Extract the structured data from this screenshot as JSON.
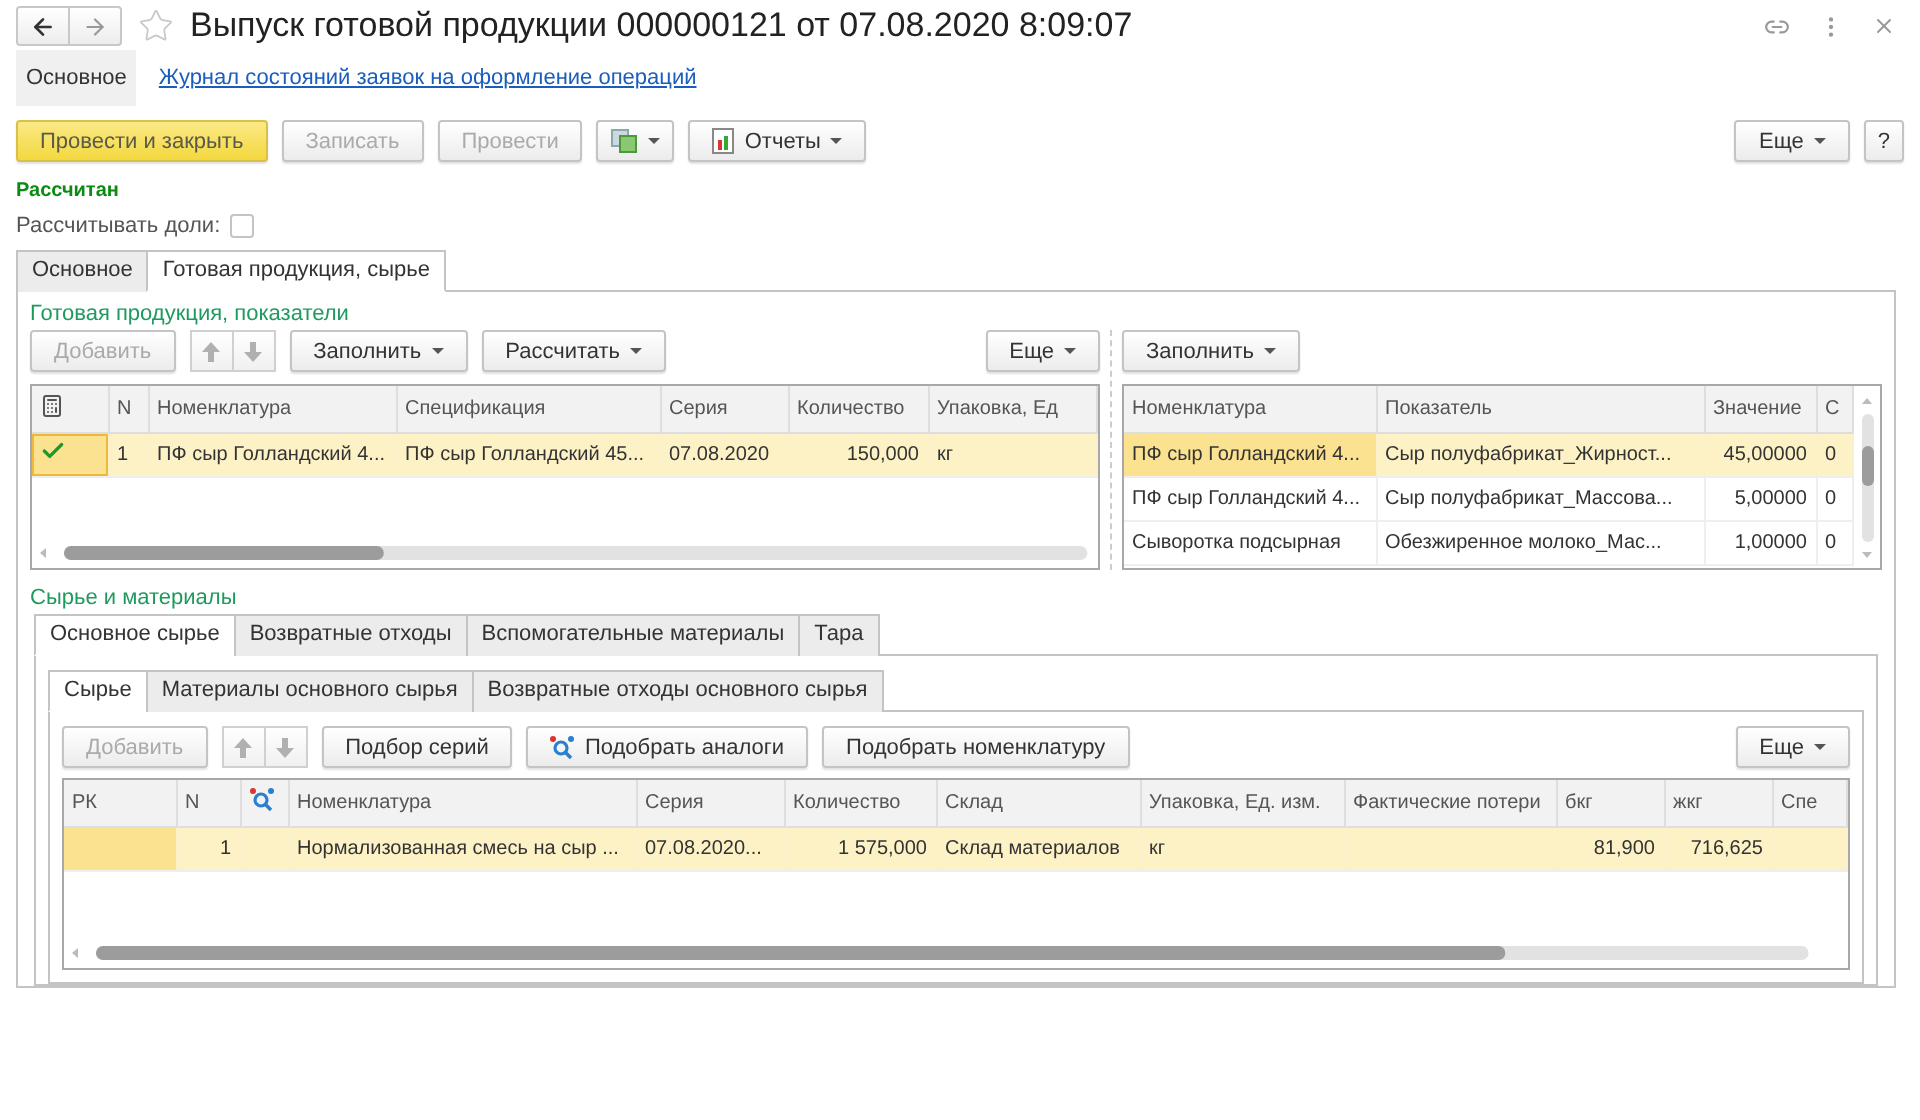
{
  "window": {
    "title": "Выпуск готовой продукции 000000121 от 07.08.2020 8:09:07"
  },
  "form_nav": [
    {
      "label": "Основное",
      "selected": true
    },
    {
      "label": "Журнал состояний заявок на оформление операций",
      "selected": false
    }
  ],
  "toolbar": {
    "buttons": [
      {
        "label": "Провести и закрыть",
        "kind": "primary",
        "disabled": false
      },
      {
        "label": "Записать",
        "kind": "plain",
        "disabled": true
      },
      {
        "label": "Провести",
        "kind": "plain",
        "disabled": true
      },
      {
        "kind": "related",
        "disabled": false
      },
      {
        "label": "Отчеты",
        "kind": "reports",
        "disabled": false
      }
    ],
    "right": [
      {
        "label": "Еще",
        "kind": "menu",
        "disabled": false
      },
      {
        "label": "?",
        "kind": "plain",
        "disabled": false
      }
    ]
  },
  "status": "Рассчитан",
  "calc_shares": {
    "label": "Рассчитывать доли:",
    "checked": false
  },
  "tabs": [
    {
      "label": "Основное",
      "selected": false
    },
    {
      "label": "Готовая продукция, сырье",
      "selected": true
    }
  ],
  "products": {
    "title": "Готовая продукция, показатели",
    "left": {
      "toolbar": [
        {
          "label": "Добавить",
          "kind": "plain",
          "disabled": true
        },
        {
          "kind": "up",
          "disabled": true
        },
        {
          "kind": "down",
          "disabled": true
        },
        {
          "label": "Заполнить",
          "kind": "menu",
          "disabled": false
        },
        {
          "label": "Рассчитать",
          "kind": "menu",
          "disabled": false
        }
      ],
      "toolbar_right": [
        {
          "label": "Еще",
          "kind": "menu",
          "disabled": false
        }
      ],
      "columns": [
        {
          "kind": "check"
        },
        {
          "label": "N",
          "kind": "text"
        },
        {
          "label": "Номенклатура",
          "kind": "text"
        },
        {
          "label": "Спецификация",
          "kind": "text"
        },
        {
          "label": "Серия",
          "kind": "text"
        },
        {
          "label": "Количество",
          "kind": "number"
        },
        {
          "label": "Упаковка, Ед",
          "kind": "text"
        }
      ],
      "rows": [
        {
          "selected": true,
          "calculated": true,
          "cells": [
            null,
            "1",
            "ПФ сыр Голландский 4...",
            "ПФ сыр Голландский 45...",
            "07.08.2020",
            "150,000",
            "кг"
          ]
        }
      ]
    },
    "right": {
      "toolbar": [
        {
          "label": "Заполнить",
          "kind": "menu",
          "disabled": false
        }
      ],
      "columns": [
        {
          "label": "Номенклатура",
          "kind": "text"
        },
        {
          "label": "Показатель",
          "kind": "text"
        },
        {
          "label": "Значение",
          "kind": "number"
        },
        {
          "label": "С",
          "kind": "text"
        }
      ],
      "rows": [
        {
          "selected": true,
          "cells": [
            "ПФ сыр Голландский 4...",
            "Сыр полуфабрикат_Жирност...",
            "45,00000",
            "0"
          ]
        },
        {
          "selected": false,
          "cells": [
            "ПФ сыр Голландский 4...",
            "Сыр полуфабрикат_Массова...",
            "5,00000",
            "0"
          ]
        },
        {
          "selected": false,
          "cells": [
            "Сыворотка подсырная",
            "Обезжиренное молоко_Мас...",
            "1,00000",
            "0"
          ]
        }
      ]
    }
  },
  "materials": {
    "title": "Сырье и материалы",
    "tabs": [
      {
        "label": "Основное сырье",
        "selected": true
      },
      {
        "label": "Возвратные отходы",
        "selected": false
      },
      {
        "label": "Вспомогательные материалы",
        "selected": false
      },
      {
        "label": "Тара",
        "selected": false
      }
    ],
    "subtabs": [
      {
        "label": "Сырье",
        "selected": true
      },
      {
        "label": "Материалы основного сырья",
        "selected": false
      },
      {
        "label": "Возвратные отходы основного сырья",
        "selected": false
      }
    ],
    "toolbar": [
      {
        "label": "Добавить",
        "kind": "plain",
        "disabled": true
      },
      {
        "kind": "up",
        "disabled": true
      },
      {
        "kind": "down",
        "disabled": true
      },
      {
        "label": "Подбор серий",
        "kind": "plain",
        "disabled": false
      },
      {
        "label": "Подобрать аналоги",
        "kind": "analogs",
        "disabled": false
      },
      {
        "label": "Подобрать номенклатуру",
        "kind": "plain",
        "disabled": false
      }
    ],
    "toolbar_right": [
      {
        "label": "Еще",
        "kind": "menu",
        "disabled": false
      }
    ],
    "columns": [
      {
        "label": "РК",
        "kind": "text"
      },
      {
        "label": "N",
        "kind": "number"
      },
      {
        "kind": "analog"
      },
      {
        "label": "Номенклатура",
        "kind": "text"
      },
      {
        "label": "Серия",
        "kind": "text"
      },
      {
        "label": "Количество",
        "kind": "number"
      },
      {
        "label": "Склад",
        "kind": "text"
      },
      {
        "label": "Упаковка, Ед. изм.",
        "kind": "text"
      },
      {
        "label": "Фактические потери",
        "kind": "text"
      },
      {
        "label": "бкг",
        "kind": "number"
      },
      {
        "label": "жкг",
        "kind": "number"
      },
      {
        "label": "Спе",
        "kind": "text"
      }
    ],
    "rows": [
      {
        "selected": true,
        "cells": [
          null,
          "1",
          null,
          "Нормализованная смесь на сыр ...",
          "07.08.2020...",
          "1 575,000",
          "Склад материалов",
          "кг",
          null,
          "81,900",
          "716,625",
          null
        ]
      }
    ]
  }
}
